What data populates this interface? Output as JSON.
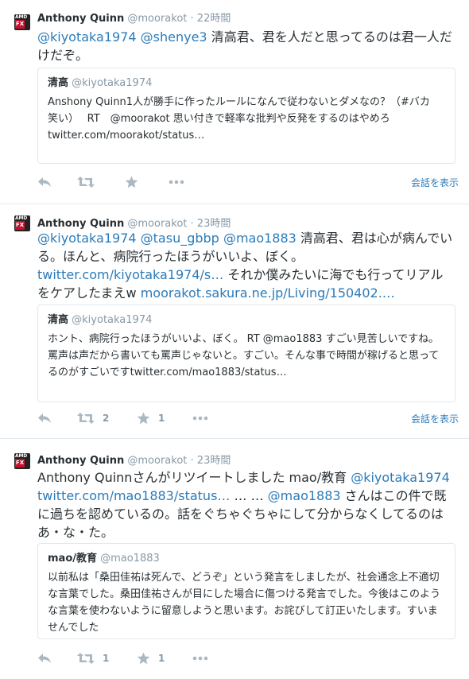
{
  "tweets": [
    {
      "author_name": "Anthony Quinn",
      "author_handle": "@moorakot",
      "time": "· 22時間",
      "text_parts": [
        {
          "t": "@kiyotaka1974",
          "link": true
        },
        {
          "t": " ",
          "link": false
        },
        {
          "t": "@shenye3",
          "link": true
        },
        {
          "t": " 清高君、君を人だと思ってるのは君一人だけだぞ。",
          "link": false
        }
      ],
      "quote": {
        "name": "清高",
        "handle": "@kiyotaka1974",
        "text": "Anshony Quinn1人が勝手に作ったルールになんで従わないとダメなの？（#バカ　笑い）　 RT　@moorakot 思い付きで軽率な批判や反発をするのはやめろ twitter.com/moorakot/status…"
      },
      "retweet_count": "",
      "favorite_count": "",
      "conversation_link": "会話を表示"
    },
    {
      "author_name": "Anthony Quinn",
      "author_handle": "@moorakot",
      "time": "· 23時間",
      "text_parts": [
        {
          "t": "@kiyotaka1974",
          "link": true
        },
        {
          "t": " ",
          "link": false
        },
        {
          "t": "@tasu_gbbp",
          "link": true
        },
        {
          "t": " ",
          "link": false
        },
        {
          "t": "@mao1883",
          "link": true
        },
        {
          "t": " 清高君、君は心が病んでいる。ほんと、病院行ったほうがいいよ、ぼく。 ",
          "link": false
        },
        {
          "t": "twitter.com/kiyotaka1974/s…",
          "link": true
        },
        {
          "t": " それか僕みたいに海でも行ってリアルをケアしたまえw ",
          "link": false
        },
        {
          "t": "moorakot.sakura.ne.jp/Living/150402.…",
          "link": true
        }
      ],
      "quote": {
        "name": "清高",
        "handle": "@kiyotaka1974",
        "text": "ホント、病院行ったほうがいいよ、ぼく。 RT @mao1883 すごい見苦しいですね。罵声は声だから書いても罵声じゃないと。すごい。そんな事で時間が稼げると思ってるのがすごいですtwitter.com/mao1883/status…"
      },
      "retweet_count": "2",
      "favorite_count": "1",
      "conversation_link": "会話を表示"
    },
    {
      "author_name": "Anthony Quinn",
      "author_handle": "@moorakot",
      "time": "· 23時間",
      "text_parts": [
        {
          "t": "Anthony Quinnさんがリツイートしました mao/教育 ",
          "link": false
        },
        {
          "t": "@kiyotaka1974",
          "link": true
        },
        {
          "t": " ",
          "link": false
        },
        {
          "t": "twitter.com/mao1883/status…",
          "link": true
        },
        {
          "t": " … … ",
          "link": false
        },
        {
          "t": "@mao1883",
          "link": true
        },
        {
          "t": " さんはこの件で既に過ちを認めているの。話をぐちゃぐちゃにして分からなくしてるのはあ・な・た。",
          "link": false
        }
      ],
      "quote": {
        "name": "mao/教育",
        "handle": "@mao1883",
        "text": "以前私は「桑田佳祐は死んで、どうぞ」という発言をしましたが、社会通念上不適切な言葉でした。桑田佳祐さんが目にした場合に傷つける発言でした。今後はこのような言葉を使わないように留意しようと思います。お詫びして訂正いたします。すいませんでした"
      },
      "retweet_count": "1",
      "favorite_count": "1",
      "conversation_link": ""
    }
  ],
  "avatar": {
    "logo_text": "AMD",
    "badge_text": "FX"
  },
  "icons": {
    "reply": "reply-icon",
    "retweet": "retweet-icon",
    "favorite": "star-icon",
    "more": "more-icon"
  },
  "colors": {
    "link": "#2b7bb9",
    "muted": "#8899a6",
    "icon": "#aab8c2",
    "border": "#e1e8ed"
  }
}
